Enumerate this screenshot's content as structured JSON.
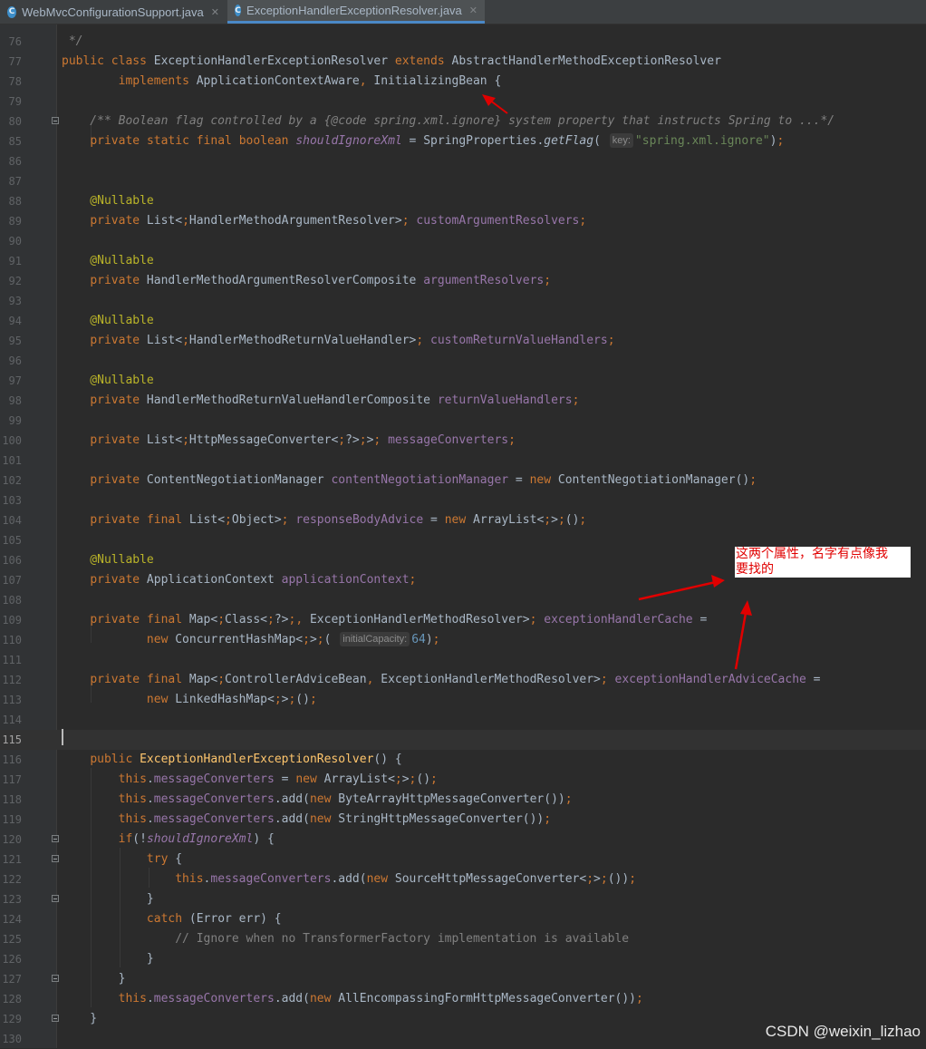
{
  "tabs": [
    {
      "label": "WebMvcConfigurationSupport.java",
      "icon": "class-c-icon"
    },
    {
      "label": "ExceptionHandlerExceptionResolver.java",
      "icon": "class-c-icon",
      "active": true
    }
  ],
  "editor": {
    "current_line": "115",
    "lines": [
      {
        "n": "76",
        "text": " */"
      },
      {
        "n": "77",
        "text": "public class ExceptionHandlerExceptionResolver extends AbstractHandlerMethodExceptionResolver"
      },
      {
        "n": "78",
        "text": "        implements ApplicationContextAware, InitializingBean {"
      },
      {
        "n": "79",
        "text": ""
      },
      {
        "n": "80",
        "text": "    /** Boolean flag controlled by a {@code spring.xml.ignore} system property that instructs Spring to ...*/"
      },
      {
        "n": "85",
        "text": "    private static final boolean shouldIgnoreXml = SpringProperties.getFlag( key: \"spring.xml.ignore\");"
      },
      {
        "n": "86",
        "text": ""
      },
      {
        "n": "87",
        "text": ""
      },
      {
        "n": "88",
        "text": "    @Nullable"
      },
      {
        "n": "89",
        "text": "    private List<HandlerMethodArgumentResolver> customArgumentResolvers;"
      },
      {
        "n": "90",
        "text": ""
      },
      {
        "n": "91",
        "text": "    @Nullable"
      },
      {
        "n": "92",
        "text": "    private HandlerMethodArgumentResolverComposite argumentResolvers;"
      },
      {
        "n": "93",
        "text": ""
      },
      {
        "n": "94",
        "text": "    @Nullable"
      },
      {
        "n": "95",
        "text": "    private List<HandlerMethodReturnValueHandler> customReturnValueHandlers;"
      },
      {
        "n": "96",
        "text": ""
      },
      {
        "n": "97",
        "text": "    @Nullable"
      },
      {
        "n": "98",
        "text": "    private HandlerMethodReturnValueHandlerComposite returnValueHandlers;"
      },
      {
        "n": "99",
        "text": ""
      },
      {
        "n": "100",
        "text": "    private List<HttpMessageConverter<?>> messageConverters;"
      },
      {
        "n": "101",
        "text": ""
      },
      {
        "n": "102",
        "text": "    private ContentNegotiationManager contentNegotiationManager = new ContentNegotiationManager();"
      },
      {
        "n": "103",
        "text": ""
      },
      {
        "n": "104",
        "text": "    private final List<Object> responseBodyAdvice = new ArrayList<>();"
      },
      {
        "n": "105",
        "text": ""
      },
      {
        "n": "106",
        "text": "    @Nullable"
      },
      {
        "n": "107",
        "text": "    private ApplicationContext applicationContext;"
      },
      {
        "n": "108",
        "text": ""
      },
      {
        "n": "109",
        "text": "    private final Map<Class<?>, ExceptionHandlerMethodResolver> exceptionHandlerCache ="
      },
      {
        "n": "110",
        "text": "            new ConcurrentHashMap<>( initialCapacity: 64);"
      },
      {
        "n": "111",
        "text": ""
      },
      {
        "n": "112",
        "text": "    private final Map<ControllerAdviceBean, ExceptionHandlerMethodResolver> exceptionHandlerAdviceCache ="
      },
      {
        "n": "113",
        "text": "            new LinkedHashMap<>();"
      },
      {
        "n": "114",
        "text": ""
      },
      {
        "n": "115",
        "text": ""
      },
      {
        "n": "116",
        "text": "    public ExceptionHandlerExceptionResolver() {"
      },
      {
        "n": "117",
        "text": "        this.messageConverters = new ArrayList<>();"
      },
      {
        "n": "118",
        "text": "        this.messageConverters.add(new ByteArrayHttpMessageConverter());"
      },
      {
        "n": "119",
        "text": "        this.messageConverters.add(new StringHttpMessageConverter());"
      },
      {
        "n": "120",
        "text": "        if(!shouldIgnoreXml) {"
      },
      {
        "n": "121",
        "text": "            try {"
      },
      {
        "n": "122",
        "text": "                this.messageConverters.add(new SourceHttpMessageConverter<>());"
      },
      {
        "n": "123",
        "text": "            }"
      },
      {
        "n": "124",
        "text": "            catch (Error err) {"
      },
      {
        "n": "125",
        "text": "                // Ignore when no TransformerFactory implementation is available"
      },
      {
        "n": "126",
        "text": "            }"
      },
      {
        "n": "127",
        "text": "        }"
      },
      {
        "n": "128",
        "text": "        this.messageConverters.add(new AllEncompassingFormHttpMessageConverter());"
      },
      {
        "n": "129",
        "text": "    }"
      },
      {
        "n": "130",
        "text": ""
      }
    ]
  },
  "annotation": {
    "note_line1": "这两个属性，名字有点像我",
    "note_line2": "要找的",
    "color": "#e00000"
  },
  "watermark": "CSDN @weixin_lizhao",
  "colors": {
    "background": "#2b2b2b",
    "gutter": "#313335",
    "keyword": "#cc7832",
    "annotation": "#bbb529",
    "field": "#9876aa",
    "string": "#6a8759",
    "number": "#6897bb",
    "comment": "#808080",
    "method_decl": "#ffc66d",
    "plain": "#a9b7c6"
  }
}
